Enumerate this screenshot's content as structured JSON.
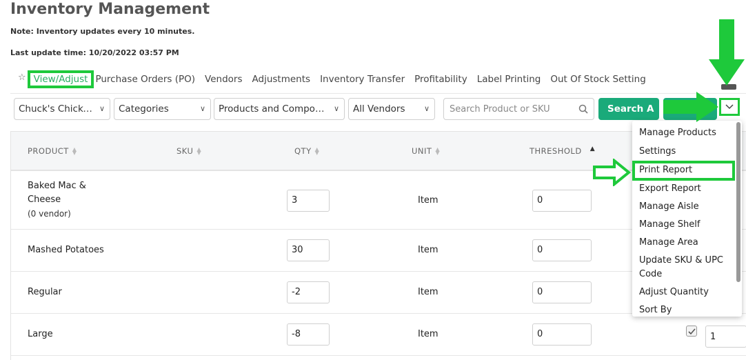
{
  "page": {
    "title": "Inventory Management",
    "note": "Note: Inventory updates every 10 minutes.",
    "last_update": "Last update time: 10/20/2022 03:57 PM"
  },
  "tabs": [
    {
      "label": "View/Adjust",
      "active": true
    },
    {
      "label": "Purchase Orders (PO)"
    },
    {
      "label": "Vendors"
    },
    {
      "label": "Adjustments"
    },
    {
      "label": "Inventory Transfer"
    },
    {
      "label": "Profitability"
    },
    {
      "label": "Label Printing"
    },
    {
      "label": "Out Of Stock Setting"
    }
  ],
  "filters": {
    "store": "Chuck's Chicken",
    "categories": "Categories",
    "product_type": "Products and Compone...",
    "vendors": "All Vendors",
    "search_placeholder": "Search Product or SKU",
    "search_button": "Search A"
  },
  "table": {
    "headers": {
      "product": "PRODUCT",
      "sku": "SKU",
      "qty": "QTY",
      "unit": "UNIT",
      "threshold": "THRESHOLD"
    },
    "rows": [
      {
        "product_line1": "Baked Mac &",
        "product_line2": "Cheese",
        "vendor": "(0 vendor)",
        "qty": "3",
        "unit": "Item",
        "threshold": "0"
      },
      {
        "product_line1": "Mashed Potatoes",
        "qty": "30",
        "unit": "Item",
        "threshold": "0"
      },
      {
        "product_line1": "Regular",
        "qty": "-2",
        "unit": "Item",
        "threshold": "0"
      },
      {
        "product_line1": "Large",
        "qty": "-8",
        "unit": "Item",
        "threshold": "0"
      }
    ],
    "extra_value": "1"
  },
  "menu": {
    "items": [
      "Manage Products",
      "Settings",
      "Print Report",
      "Export Report",
      "Manage Aisle",
      "Manage Shelf",
      "Manage Area",
      "Update SKU & UPC Code",
      "Adjust Quantity",
      "Sort By"
    ]
  },
  "colors": {
    "accent": "#1aaa7a",
    "annotation": "#1ec93b"
  }
}
